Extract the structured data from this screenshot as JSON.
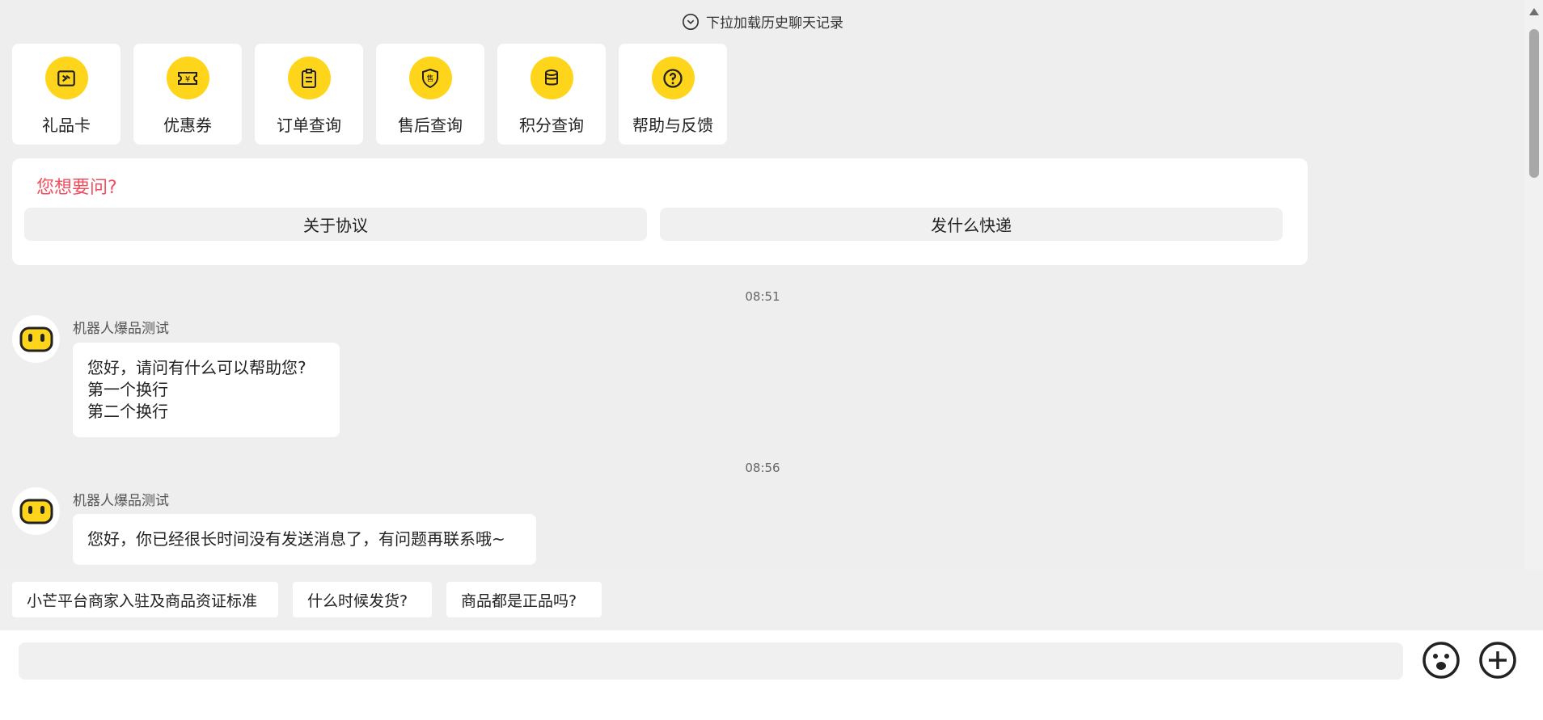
{
  "history_hint": "下拉加载历史聊天记录",
  "quick_cards": [
    {
      "label": "礼品卡",
      "icon": "gift-card-icon"
    },
    {
      "label": "优惠券",
      "icon": "coupon-icon"
    },
    {
      "label": "订单查询",
      "icon": "order-clipboard-icon"
    },
    {
      "label": "售后查询",
      "icon": "after-sales-shield-icon"
    },
    {
      "label": "积分查询",
      "icon": "points-coins-icon"
    },
    {
      "label": "帮助与反馈",
      "icon": "help-question-icon"
    }
  ],
  "ask": {
    "title": "您想要问?",
    "options": [
      "关于协议",
      "发什么快递"
    ]
  },
  "messages": [
    {
      "time": "08:51",
      "sender": "机器人爆品测试",
      "lines": [
        "您好，请问有什么可以帮助您?",
        "第一个换行",
        "第二个换行"
      ]
    },
    {
      "time": "08:56",
      "sender": "机器人爆品测试",
      "lines": [
        "您好，你已经很长时间没有发送消息了，有问题再联系哦~"
      ]
    }
  ],
  "suggestions": [
    "小芒平台商家入驻及商品资证标准",
    "什么时候发货?",
    "商品都是正品吗?"
  ],
  "input": {
    "placeholder": ""
  },
  "colors": {
    "accent_yellow": "#ffd51c",
    "ask_title_red": "#f04e5e",
    "background": "#eeeeee"
  }
}
